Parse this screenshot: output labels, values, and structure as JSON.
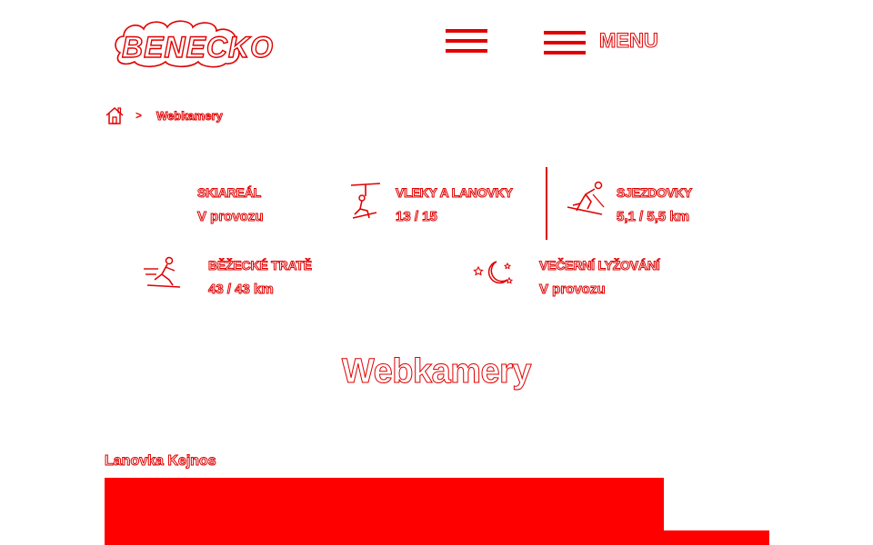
{
  "header": {
    "logo_text": "BENECKO",
    "menu_label": "MENU"
  },
  "breadcrumb": {
    "separator": ">",
    "current": "Webkamery"
  },
  "stats": [
    {
      "title": "SKIAREÁL",
      "value": "V provozu"
    },
    {
      "title": "VLEKY A LANOVKY",
      "value": "13 / 15"
    },
    {
      "title": "SJEZDOVKY",
      "value": "5,1 / 5,5 km"
    },
    {
      "title": "BĚŽECKÉ TRATĚ",
      "value": "43 / 43 km"
    },
    {
      "title": "VEČERNÍ LYŽOVÁNÍ",
      "value": "V provozu"
    }
  ],
  "page_title": "Webkamery",
  "webcams": [
    {
      "title": "Lanovka Kejnos"
    }
  ],
  "colors": {
    "accent": "#e00000",
    "camera_frame": "#ff0000",
    "background": "#ffffff"
  }
}
